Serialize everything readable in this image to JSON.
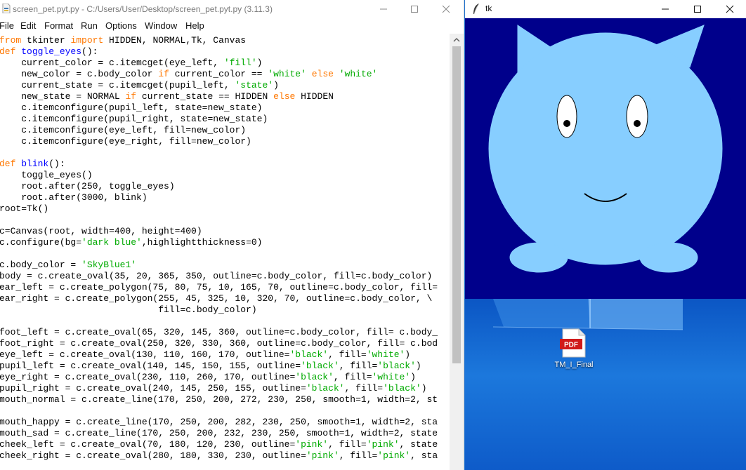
{
  "editor": {
    "title": "screen_pet.pyt.py - C:/Users/User/Desktop/screen_pet.pyt.py (3.11.3)",
    "menu": [
      "File",
      "Edit",
      "Format",
      "Run",
      "Options",
      "Window",
      "Help"
    ],
    "code_lines": [
      "from tkinter import HIDDEN, NORMAL,Tk, Canvas",
      "def toggle_eyes():",
      "    current_color = c.itemcget(eye_left, 'fill')",
      "    new_color = c.body_color if current_color == 'white' else 'white'",
      "    current_state = c.itemcget(pupil_left, 'state')",
      "    new_state = NORMAL if current_state == HIDDEN else HIDDEN",
      "    c.itemconfigure(pupil_left, state=new_state)",
      "    c.itemconfigure(pupil_right, state=new_state)",
      "    c.itemconfigure(eye_left, fill=new_color)",
      "    c.itemconfigure(eye_right, fill=new_color)",
      "",
      "def blink():",
      "    toggle_eyes()",
      "    root.after(250, toggle_eyes)",
      "    root.after(3000, blink)",
      "root=Tk()",
      "",
      "c=Canvas(root, width=400, height=400)",
      "c.configure(bg='dark blue',highlightthickness=0)",
      "",
      "c.body_color = 'SkyBlue1'",
      "body = c.create_oval(35, 20, 365, 350, outline=c.body_color, fill=c.body_color)",
      "ear_left = c.create_polygon(75, 80, 75, 10, 165, 70, outline=c.body_color, fill=",
      "ear_right = c.create_polygon(255, 45, 325, 10, 320, 70, outline=c.body_color, \\",
      "                             fill=c.body_color)",
      "",
      "foot_left = c.create_oval(65, 320, 145, 360, outline=c.body_color, fill= c.body_",
      "foot_right = c.create_oval(250, 320, 330, 360, outline=c.body_color, fill= c.bod",
      "eye_left = c.create_oval(130, 110, 160, 170, outline='black', fill='white')",
      "pupil_left = c.create_oval(140, 145, 150, 155, outline='black', fill='black')",
      "eye_right = c.create_oval(230, 110, 260, 170, outline='black', fill='white')",
      "pupil_right = c.create_oval(240, 145, 250, 155, outline='black', fill='black')",
      "mouth_normal = c.create_line(170, 250, 200, 272, 230, 250, smooth=1, width=2, st",
      "",
      "mouth_happy = c.create_line(170, 250, 200, 282, 230, 250, smooth=1, width=2, sta",
      "mouth_sad = c.create_line(170, 250, 200, 232, 230, 250, smooth=1, width=2, state",
      "cheek_left = c.create_oval(70, 180, 120, 230, outline='pink', fill='pink', state",
      "cheek_right = c.create_oval(280, 180, 330, 230, outline='pink', fill='pink', sta"
    ],
    "syntax_colors": {
      "keyword": "#ff7700",
      "builtin_def": "#0000ff",
      "string": "#00aa00"
    }
  },
  "tk_window": {
    "title": "tk",
    "canvas_bg": "#00008b",
    "body_color": "#87ceff"
  },
  "desktop": {
    "file_label": "TM_I_Final",
    "file_badge": "PDF"
  }
}
